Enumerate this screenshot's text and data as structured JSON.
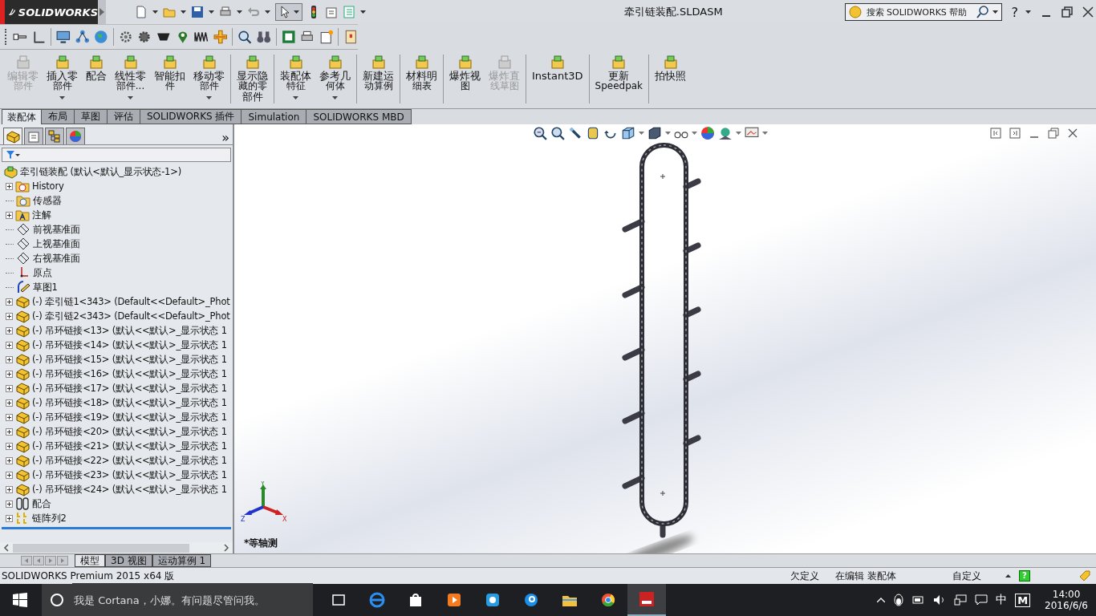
{
  "title_bar": {
    "logo": "SOLIDWORKS",
    "title": "牵引链装配.SLDASM",
    "search": {
      "placeholder": "搜索 SOLIDWORKS 帮助"
    },
    "help": "?"
  },
  "command_manager": {
    "groups": [
      [
        {
          "lines": [
            "编辑零",
            "部件"
          ],
          "disabled": true,
          "dropdown": false
        },
        {
          "lines": [
            "插入零",
            "部件"
          ],
          "disabled": false,
          "dropdown": true
        },
        {
          "lines": [
            "配合"
          ],
          "disabled": false,
          "dropdown": false
        },
        {
          "lines": [
            "线性零",
            "部件..."
          ],
          "disabled": false,
          "dropdown": true
        },
        {
          "lines": [
            "智能扣",
            "件"
          ],
          "disabled": false,
          "dropdown": false
        },
        {
          "lines": [
            "移动零",
            "部件"
          ],
          "disabled": false,
          "dropdown": true
        }
      ],
      [
        {
          "lines": [
            "显示隐",
            "藏的零",
            "部件"
          ],
          "disabled": false,
          "dropdown": false
        }
      ],
      [
        {
          "lines": [
            "装配体",
            "特征"
          ],
          "disabled": false,
          "dropdown": true
        },
        {
          "lines": [
            "参考几",
            "何体"
          ],
          "disabled": false,
          "dropdown": true
        }
      ],
      [
        {
          "lines": [
            "新建运",
            "动算例"
          ],
          "disabled": false,
          "dropdown": false
        }
      ],
      [
        {
          "lines": [
            "材料明",
            "细表"
          ],
          "disabled": false,
          "dropdown": false
        }
      ],
      [
        {
          "lines": [
            "爆炸视",
            "图"
          ],
          "disabled": false,
          "dropdown": false
        },
        {
          "lines": [
            "爆炸直",
            "线草图"
          ],
          "disabled": true,
          "dropdown": false
        }
      ],
      [
        {
          "lines": [
            "Instant3D"
          ],
          "disabled": false,
          "dropdown": false
        }
      ],
      [
        {
          "lines": [
            "更新",
            "Speedpak"
          ],
          "disabled": false,
          "dropdown": false
        }
      ],
      [
        {
          "lines": [
            "拍快照"
          ],
          "disabled": false,
          "dropdown": false
        }
      ]
    ]
  },
  "tabs": [
    {
      "label": "装配体",
      "selected": true
    },
    {
      "label": "布局",
      "selected": false
    },
    {
      "label": "草图",
      "selected": false
    },
    {
      "label": "评估",
      "selected": false
    },
    {
      "label": "SOLIDWORKS 插件",
      "selected": false
    },
    {
      "label": "Simulation",
      "selected": false
    },
    {
      "label": "SOLIDWORKS MBD",
      "selected": false
    }
  ],
  "feature_tree": {
    "more": "»",
    "root": "牵引链装配  (默认<默认_显示状态-1>)",
    "items": [
      {
        "label": "History",
        "kind": "history",
        "expandable": true
      },
      {
        "label": "传感器",
        "kind": "sensor",
        "expandable": false
      },
      {
        "label": "注解",
        "kind": "annotation",
        "expandable": true
      },
      {
        "label": "前视基准面",
        "kind": "plane",
        "expandable": false
      },
      {
        "label": "上视基准面",
        "kind": "plane",
        "expandable": false
      },
      {
        "label": "右视基准面",
        "kind": "plane",
        "expandable": false
      },
      {
        "label": "原点",
        "kind": "origin",
        "expandable": false
      },
      {
        "label": "草图1",
        "kind": "sketch",
        "expandable": false
      },
      {
        "label": "(-) 牵引链1<343> (Default<<Default>_Phot",
        "kind": "part",
        "expandable": true
      },
      {
        "label": "(-) 牵引链2<343> (Default<<Default>_Phot",
        "kind": "part",
        "expandable": true
      },
      {
        "label": "(-) 吊环链接<13> (默认<<默认>_显示状态 1",
        "kind": "part",
        "expandable": true
      },
      {
        "label": "(-) 吊环链接<14> (默认<<默认>_显示状态 1",
        "kind": "part",
        "expandable": true
      },
      {
        "label": "(-) 吊环链接<15> (默认<<默认>_显示状态 1",
        "kind": "part",
        "expandable": true
      },
      {
        "label": "(-) 吊环链接<16> (默认<<默认>_显示状态 1",
        "kind": "part",
        "expandable": true
      },
      {
        "label": "(-) 吊环链接<17> (默认<<默认>_显示状态 1",
        "kind": "part",
        "expandable": true
      },
      {
        "label": "(-) 吊环链接<18> (默认<<默认>_显示状态 1",
        "kind": "part",
        "expandable": true
      },
      {
        "label": "(-) 吊环链接<19> (默认<<默认>_显示状态 1",
        "kind": "part",
        "expandable": true
      },
      {
        "label": "(-) 吊环链接<20> (默认<<默认>_显示状态 1",
        "kind": "part",
        "expandable": true
      },
      {
        "label": "(-) 吊环链接<21> (默认<<默认>_显示状态 1",
        "kind": "part",
        "expandable": true
      },
      {
        "label": "(-) 吊环链接<22> (默认<<默认>_显示状态 1",
        "kind": "part",
        "expandable": true
      },
      {
        "label": "(-) 吊环链接<23> (默认<<默认>_显示状态 1",
        "kind": "part",
        "expandable": true
      },
      {
        "label": "(-) 吊环链接<24> (默认<<默认>_显示状态 1",
        "kind": "part",
        "expandable": true
      },
      {
        "label": "配合",
        "kind": "mates",
        "expandable": true
      },
      {
        "label": "链阵列2",
        "kind": "pattern",
        "expandable": true
      }
    ]
  },
  "viewport": {
    "triad": {
      "x": "X",
      "y": "Y",
      "z": "Z"
    },
    "view_name": "*等轴测"
  },
  "bottom_tabs": [
    {
      "label": "模型",
      "selected": true
    },
    {
      "label": "3D 视图",
      "selected": false
    },
    {
      "label": "运动算例 1",
      "selected": false
    }
  ],
  "status_bar": {
    "product": "SOLIDWORKS Premium 2015 x64 版",
    "fields": [
      "欠定义",
      "在编辑 装配体",
      "自定义"
    ],
    "help": "?"
  },
  "taskbar": {
    "search_placeholder": "我是 Cortana，小娜。有问题尽管问我。",
    "ime": "中",
    "ime_mode": "M",
    "time": "14:00",
    "date": "2016/6/6"
  }
}
